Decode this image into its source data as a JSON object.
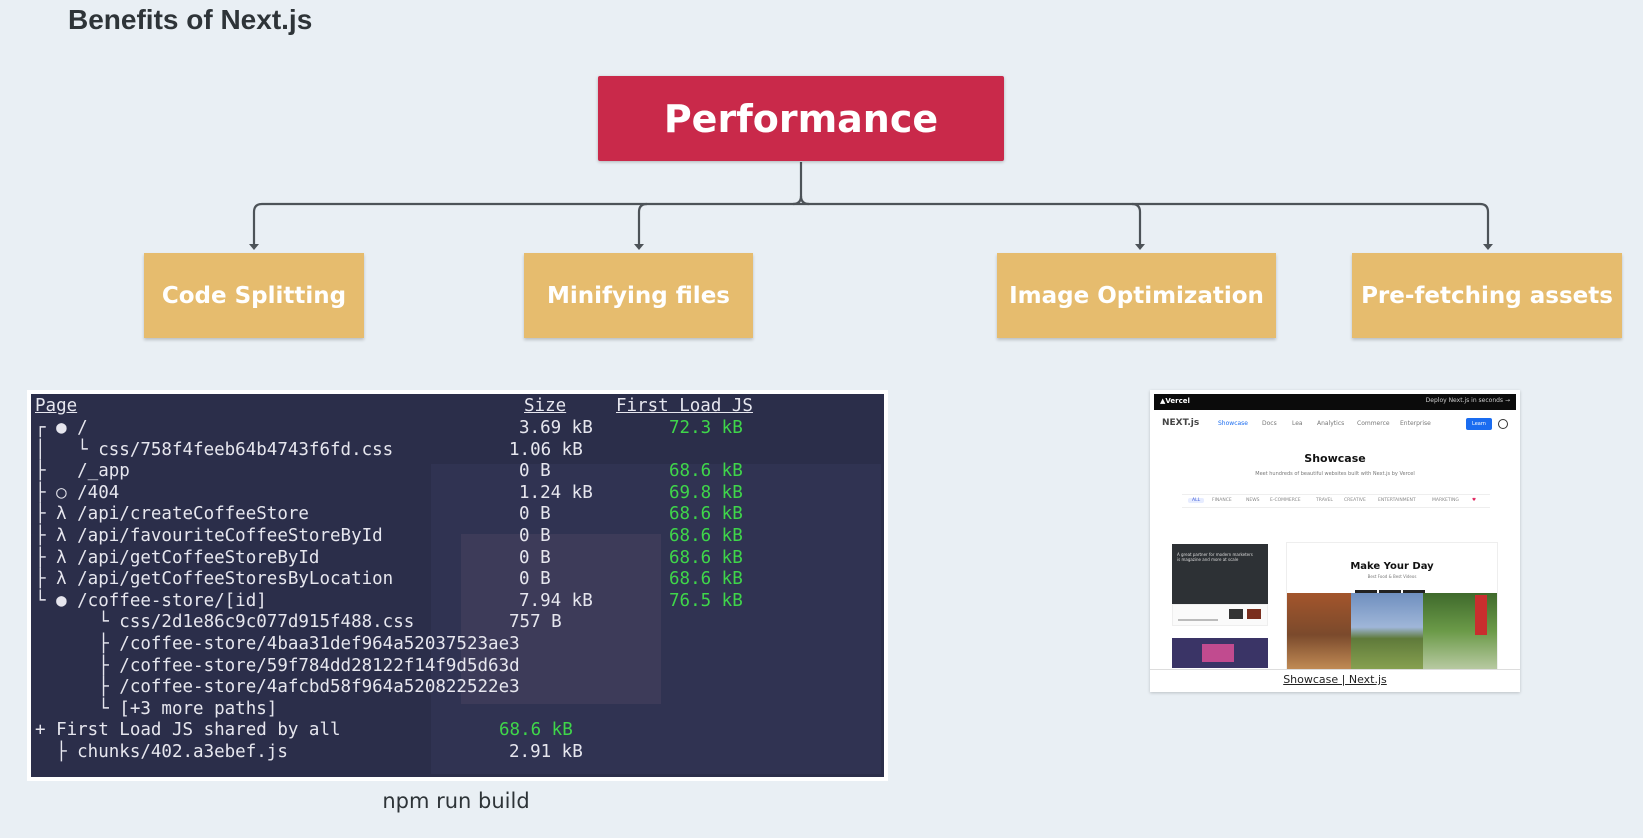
{
  "title": "Benefits of Next.js",
  "root": {
    "label": "Performance",
    "color": "#c9294a"
  },
  "leaves": [
    {
      "label": "Code Splitting"
    },
    {
      "label": "Minifying files"
    },
    {
      "label": "Image Optimization"
    },
    {
      "label": "Pre-fetching assets"
    }
  ],
  "leaf_color": "#e6bc6e",
  "terminal": {
    "headers": {
      "page": "Page",
      "size": "Size",
      "load": "First Load JS"
    },
    "lines": [
      {
        "text": "┌ ● /",
        "size": "3.69 kB",
        "load": "72.3 kB"
      },
      {
        "text": "│   └ css/758f4feeb64b4743f6fd.css",
        "size": "1.06 kB",
        "load": ""
      },
      {
        "text": "├   /_app",
        "size": "0 B",
        "load": "68.6 kB"
      },
      {
        "text": "├ ○ /404",
        "size": "1.24 kB",
        "load": "69.8 kB"
      },
      {
        "text": "├ λ /api/createCoffeeStore",
        "size": "0 B",
        "load": "68.6 kB"
      },
      {
        "text": "├ λ /api/favouriteCoffeeStoreById",
        "size": "0 B",
        "load": "68.6 kB"
      },
      {
        "text": "├ λ /api/getCoffeeStoreById",
        "size": "0 B",
        "load": "68.6 kB"
      },
      {
        "text": "├ λ /api/getCoffeeStoresByLocation",
        "size": "0 B",
        "load": "68.6 kB"
      },
      {
        "text": "└ ● /coffee-store/[id]",
        "size": "7.94 kB",
        "load": "76.5 kB"
      },
      {
        "text": "      └ css/2d1e86c9c077d915f488.css",
        "size": "757 B",
        "load": ""
      },
      {
        "text": "      ├ /coffee-store/4baa31def964a52037523ae3",
        "size": "",
        "load": ""
      },
      {
        "text": "      ├ /coffee-store/59f784dd28122f14f9d5d63d",
        "size": "",
        "load": ""
      },
      {
        "text": "      ├ /coffee-store/4afcbd58f964a520822522e3",
        "size": "",
        "load": ""
      },
      {
        "text": "      └ [+3 more paths]",
        "size": "",
        "load": ""
      },
      {
        "text": "+ First Load JS shared by all",
        "size": "68.6 kB",
        "load": ""
      },
      {
        "text": "  ├ chunks/402.a3ebef.js",
        "size": "2.91 kB",
        "load": ""
      }
    ],
    "caption": "npm run build"
  },
  "showcase": {
    "brand": "▲Vercel",
    "deploy": "Deploy Next.js in seconds →",
    "logo": "NEXT.js",
    "nav": [
      "Showcase",
      "Docs",
      "Lea",
      "Analytics",
      "Commerce",
      "Enterprise"
    ],
    "learn": "Learn",
    "title": "Showcase",
    "subtitle": "Meet hundreds of beautiful websites built with Next.js by Vercel",
    "filters": [
      "ALL",
      "FINANCE",
      "NEWS",
      "E-COMMERCE",
      "TRAVEL",
      "CREATIVE",
      "ENTERTAINMENT",
      "MARKETING",
      "♥"
    ],
    "card_text": "A great partner for modern marketers is magazine and more at scale",
    "hero_title": "Make Your Day",
    "hero_sub": "Best Food & Best Videos",
    "caption": "Showcase | Next.js"
  }
}
